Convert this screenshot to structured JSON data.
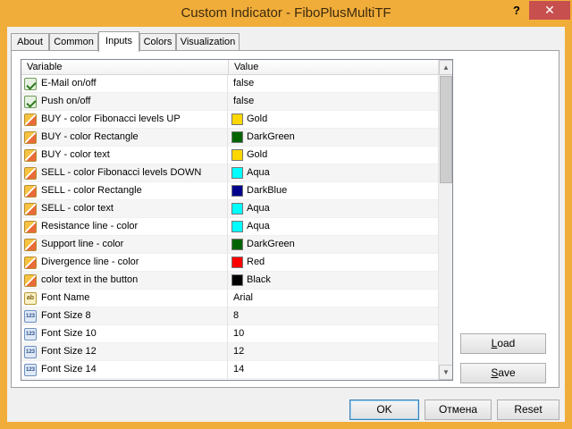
{
  "window": {
    "title": "Custom Indicator - FiboPlusMultiTF",
    "help_label": "?",
    "close_label": "✕"
  },
  "tabs": [
    {
      "label": "About",
      "active": false
    },
    {
      "label": "Common",
      "active": false
    },
    {
      "label": "Inputs",
      "active": true
    },
    {
      "label": "Colors",
      "active": false
    },
    {
      "label": "Visualization",
      "active": false
    }
  ],
  "grid": {
    "columns": {
      "variable": "Variable",
      "value": "Value"
    },
    "rows": [
      {
        "icon": "bool-icon",
        "variable": "E-Mail on/off",
        "value": "false"
      },
      {
        "icon": "bool-icon",
        "variable": "Push on/off",
        "value": "false"
      },
      {
        "icon": "color-icon",
        "variable": "BUY -  color Fibonacci levels UP",
        "value": "Gold",
        "swatch": "#ffd700"
      },
      {
        "icon": "color-icon",
        "variable": "BUY -  color Rectangle",
        "value": "DarkGreen",
        "swatch": "#006400"
      },
      {
        "icon": "color-icon",
        "variable": "BUY -  color text",
        "value": "Gold",
        "swatch": "#ffd700"
      },
      {
        "icon": "color-icon",
        "variable": "SELL - color Fibonacci levels DOWN",
        "value": "Aqua",
        "swatch": "#00ffff"
      },
      {
        "icon": "color-icon",
        "variable": "SELL - color Rectangle",
        "value": "DarkBlue",
        "swatch": "#00008b"
      },
      {
        "icon": "color-icon",
        "variable": "SELL - color text",
        "value": "Aqua",
        "swatch": "#00ffff"
      },
      {
        "icon": "color-icon",
        "variable": "Resistance line - color",
        "value": "Aqua",
        "swatch": "#00ffff"
      },
      {
        "icon": "color-icon",
        "variable": "Support line - color",
        "value": "DarkGreen",
        "swatch": "#006400"
      },
      {
        "icon": "color-icon",
        "variable": "Divergence line - color",
        "value": "Red",
        "swatch": "#ff0000"
      },
      {
        "icon": "color-icon",
        "variable": "color text in the button",
        "value": "Black",
        "swatch": "#000000"
      },
      {
        "icon": "string-icon",
        "variable": "Font Name",
        "value": "Arial"
      },
      {
        "icon": "number-icon",
        "variable": "Font Size 8",
        "value": "8"
      },
      {
        "icon": "number-icon",
        "variable": "Font Size 10",
        "value": "10"
      },
      {
        "icon": "number-icon",
        "variable": "Font Size 12",
        "value": "12"
      },
      {
        "icon": "number-icon",
        "variable": "Font Size 14",
        "value": "14"
      }
    ],
    "scroll_up": "▲",
    "scroll_down": "▼"
  },
  "icons": {
    "bool-icon": "",
    "color-icon": "",
    "string-icon": "ab",
    "number-icon": "123"
  },
  "buttons": {
    "load": {
      "prefix": "",
      "mnemonic": "L",
      "rest": "oad"
    },
    "save": {
      "prefix": "",
      "mnemonic": "S",
      "rest": "ave"
    },
    "ok": "OK",
    "cancel": "Отмена",
    "reset": "Reset"
  }
}
